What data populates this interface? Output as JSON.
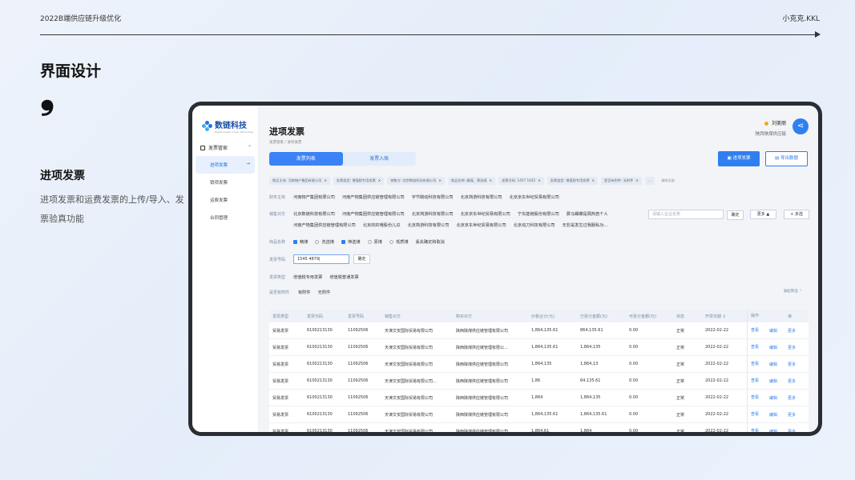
{
  "slide": {
    "header": "2022B端供应链升级优化",
    "author": "小克克.KKL",
    "title": "界面设计",
    "quote": "❟",
    "section_title": "进项发票",
    "section_desc": "进项发票和运费发票的上传/导入、发票验真功能"
  },
  "app": {
    "logo_text": "数链科技",
    "logo_sub": "Digital Supply Chain Technology",
    "nav_group": "发票管家",
    "nav_items": [
      "进项发票",
      "销项发票",
      "运费发票",
      "合同管理"
    ],
    "page_title": "进项发票",
    "breadcrumb": "发票管家  /  进项发票",
    "user_name": "刘美丽",
    "user_org": "陕西陕煤供应链",
    "tabs": [
      "发票列表",
      "发票入账"
    ],
    "btn_add": "进项发票",
    "btn_export": "导出数据",
    "chips": [
      "购买主体: 河南物产集团有限公司",
      "发票类型: 增值税专用发票",
      "销售方: 北京数链科技有限公司",
      "商品名称: 精煤、筛选煤",
      "发票号码: 1457 1645",
      "发票类型: 增值税专用发票",
      "是否有附件: 无附件",
      "…"
    ],
    "chip_clear": "清除全部",
    "filters": {
      "buyer_label": "财务主体",
      "buyer_opts": [
        "河南物产集团有限公司",
        "河南产物集团供应链管理有限公司",
        "宇节跳动科技有限公司",
        "北京简游科技有限公司",
        "北京京东世纪贸易有限公司"
      ],
      "seller_label": "销售对方",
      "seller_row1": [
        "北京数链科技有限公司",
        "河南产物集团供应链管理有限公司",
        "北京简游科技有限公司",
        "北京京东世纪贸易有限公司",
        "宁东能链股份有限公司",
        "费马蝴蝶是隔热若个人"
      ],
      "seller_row2": [
        "河南产物集团供应链管理有限公司",
        "北京的的哦股份儿瓜",
        "北京简游科技有限公司",
        "北京京东世纪贸易有限公司",
        "北京动刀科技有限公司",
        "无非是发生过我服私功..."
      ],
      "seller_search_placeholder": "请输入企业名称",
      "confirm": "确定",
      "more": "更多 ▲",
      "multi": "+ 多选",
      "goods_label": "商品名称",
      "goods_opts": [
        {
          "label": "精煤",
          "checked": true,
          "type": "checkbox"
        },
        {
          "label": "洗选煤",
          "checked": false,
          "type": "radio"
        },
        {
          "label": "筛选煤",
          "checked": true,
          "type": "checkbox"
        },
        {
          "label": "原煤",
          "checked": false,
          "type": "radio"
        },
        {
          "label": "低质煤",
          "checked": false,
          "type": "radio"
        },
        {
          "label": "丢失确定和取消",
          "checked": false,
          "type": "text"
        }
      ],
      "number_label": "发票号码",
      "number_value": "1545 4879|",
      "type_label": "发票类型",
      "type_opts": [
        "增值税专用发票",
        "增值税普通发票"
      ],
      "attach_label": "是否有附件",
      "attach_opts": [
        "有附件",
        "无附件"
      ],
      "collapse": "收起筛选 ⌃"
    },
    "table": {
      "columns": [
        "发票类型",
        "发票代码",
        "发票号码",
        "销售对方",
        "购买对方",
        "价税合计(元)",
        "已拆分金额(元)",
        "可拆分金额(元)",
        "状态",
        "开票日期 ⇕",
        "操作",
        "",
        "⚙"
      ],
      "rows": [
        [
          "贸易发票",
          "6100213130",
          "11092506",
          "天津文安国际贸易有限公司",
          "陕西陕煤供应链管理有限公司",
          "1,864,135.61",
          "864,135.61",
          "0.00",
          "正常",
          "2022-02-22",
          "查看",
          "编辑",
          "更多"
        ],
        [
          "贸易发票",
          "6100213130",
          "11092506",
          "天津文安国际贸易有限公司",
          "陕西陕煤供应链管理有限公...",
          "1,864,135.61",
          "1,864,135",
          "0.00",
          "正常",
          "2022-02-22",
          "查看",
          "编辑",
          "更多"
        ],
        [
          "贸易发票",
          "6100213130",
          "11092506",
          "天津文安国际贸易有限公司",
          "陕西陕煤供应链管理有限公司",
          "1,864,135",
          "1,864,13",
          "0.00",
          "正常",
          "2022-02-22",
          "查看",
          "编辑",
          "更多"
        ],
        [
          "贸易发票",
          "6100213130",
          "11092506",
          "天津文安国际贸易有限公司...",
          "陕西陕煤供应链管理有限公司",
          "1,86",
          "64,135.61",
          "0.00",
          "正常",
          "2022-02-22",
          "查看",
          "编辑",
          "更多"
        ],
        [
          "贸易发票",
          "6100213130",
          "11092506",
          "天津文安国际贸易有限公司",
          "陕西陕煤供应链管理有限公司",
          "1,864",
          "1,864,135",
          "0.00",
          "正常",
          "2022-02-22",
          "查看",
          "编辑",
          "更多"
        ],
        [
          "贸易发票",
          "6100213130",
          "11092506",
          "天津文安国际贸易有限公司",
          "陕西陕煤供应链管理有限公司",
          "1,864,135.61",
          "1,864,135.61",
          "0.00",
          "正常",
          "2022-02-22",
          "查看",
          "编辑",
          "更多"
        ],
        [
          "贸易发票",
          "6100213130",
          "11092506",
          "天津文安国际贸易有限公司",
          "陕西陕煤供应链管理有限公司",
          "1,864,61",
          "1,864",
          "0.00",
          "正常",
          "2022-02-22",
          "查看",
          "编辑",
          "更多"
        ]
      ]
    }
  },
  "colors": {
    "accent": "#2f7ff0",
    "device": "#2a2d33"
  }
}
